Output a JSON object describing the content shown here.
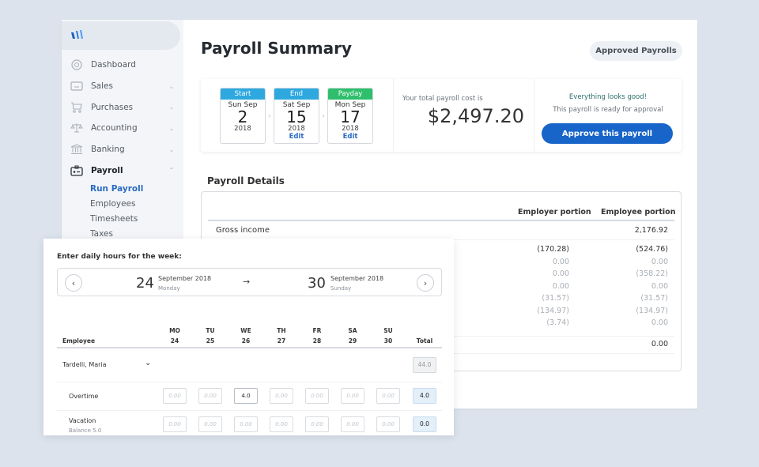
{
  "sidebar": {
    "logo": "wix-logo",
    "items": [
      {
        "label": "Dashboard",
        "icon": "dashboard-icon",
        "expandable": false
      },
      {
        "label": "Sales",
        "icon": "credit-card-icon",
        "expandable": true
      },
      {
        "label": "Purchases",
        "icon": "cart-icon",
        "expandable": true
      },
      {
        "label": "Accounting",
        "icon": "scales-icon",
        "expandable": true
      },
      {
        "label": "Banking",
        "icon": "bank-icon",
        "expandable": true
      },
      {
        "label": "Payroll",
        "icon": "id-badge-icon",
        "expandable": true,
        "expanded": true
      }
    ],
    "payroll_sub": [
      "Run Payroll",
      "Employees",
      "Timesheets",
      "Taxes"
    ],
    "active_sub": "Run Payroll"
  },
  "header": {
    "title": "Payroll Summary",
    "approved_button": "Approved Payrolls"
  },
  "summary": {
    "dates": [
      {
        "label": "Start",
        "dow": "Sun Sep",
        "day": "2",
        "year": "2018",
        "edit": "",
        "color": "#2ea8df"
      },
      {
        "label": "End",
        "dow": "Sat Sep",
        "day": "15",
        "year": "2018",
        "edit": "Edit",
        "color": "#2ea8df"
      },
      {
        "label": "Payday",
        "dow": "Mon Sep",
        "day": "17",
        "year": "2018",
        "edit": "Edit",
        "color": "#2fbf6c"
      }
    ],
    "cost_label": "Your total payroll cost is",
    "cost_value": "$2,497.20",
    "status_title": "Everything looks good!",
    "status_sub": "This payroll is ready for approval",
    "approve_button": "Approve this payroll"
  },
  "details": {
    "title": "Payroll Details",
    "columns": [
      "Employer portion",
      "Employee portion"
    ],
    "gross_label": "Gross income",
    "gross_employee": "2,176.92",
    "rows": [
      {
        "employer": "(170.28)",
        "employee": "(524.76)",
        "emphasis": true
      },
      {
        "employer": "0.00",
        "employee": "0.00",
        "emphasis": false
      },
      {
        "employer": "0.00",
        "employee": "(358.22)",
        "emphasis": false
      },
      {
        "employer": "0.00",
        "employee": "0.00",
        "emphasis": false
      },
      {
        "employer": "(31.57)",
        "employee": "(31.57)",
        "emphasis": false
      },
      {
        "employer": "(134.97)",
        "employee": "(134.97)",
        "emphasis": false
      },
      {
        "employer": "(3.74)",
        "employee": "0.00",
        "emphasis": false
      }
    ],
    "total_employee": "0.00"
  },
  "timesheet": {
    "title": "Enter daily hours for the week:",
    "start": {
      "day": "24",
      "month_year": "September 2018",
      "dow": "Monday"
    },
    "end": {
      "day": "30",
      "month_year": "September 2018",
      "dow": "Sunday"
    },
    "employee_header": "Employee",
    "total_header": "Total",
    "days": [
      {
        "dow": "MO",
        "date": "24"
      },
      {
        "dow": "TU",
        "date": "25"
      },
      {
        "dow": "WE",
        "date": "26"
      },
      {
        "dow": "TH",
        "date": "27"
      },
      {
        "dow": "FR",
        "date": "28"
      },
      {
        "dow": "SA",
        "date": "29"
      },
      {
        "dow": "SU",
        "date": "30"
      }
    ],
    "employee": {
      "name": "Tardelli, Maria",
      "total": "44.0"
    },
    "rows": [
      {
        "label": "Overtime",
        "sub": "",
        "values": [
          "",
          "",
          "4.0",
          "",
          "",
          "",
          ""
        ],
        "total": "4.0"
      },
      {
        "label": "Vacation",
        "sub": "Balance 5.0",
        "values": [
          "",
          "",
          "",
          "",
          "",
          "",
          ""
        ],
        "total": "0.0"
      }
    ],
    "placeholder": "0.00"
  }
}
